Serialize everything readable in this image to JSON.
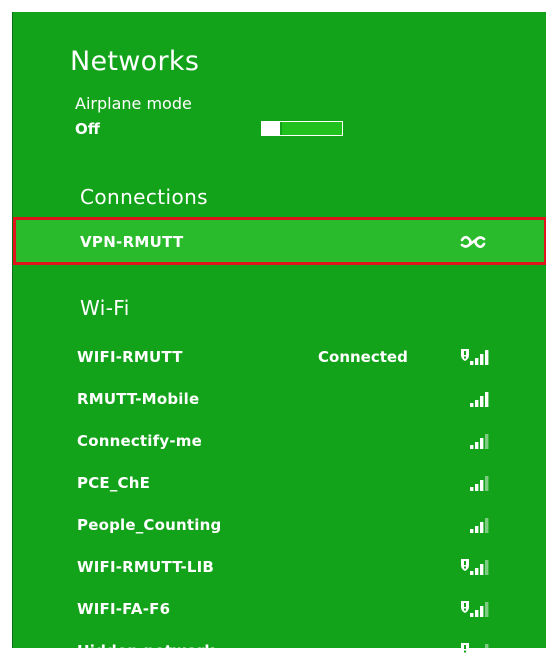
{
  "header": {
    "title": "Networks"
  },
  "airplane": {
    "label": "Airplane mode",
    "value": "Off"
  },
  "connections": {
    "title": "Connections",
    "vpn": {
      "label": "VPN-RMUTT",
      "icon": "vpn-link-icon"
    }
  },
  "wifi": {
    "title": "Wi-Fi",
    "networks": [
      {
        "name": "WIFI-RMUTT",
        "status": "Connected",
        "secured": true,
        "signal_bars": 4
      },
      {
        "name": "RMUTT-Mobile",
        "status": "",
        "secured": false,
        "signal_bars": 4
      },
      {
        "name": "Connectify-me",
        "status": "",
        "secured": false,
        "signal_bars": 3
      },
      {
        "name": "PCE_ChE",
        "status": "",
        "secured": false,
        "signal_bars": 3
      },
      {
        "name": "People_Counting",
        "status": "",
        "secured": false,
        "signal_bars": 3
      },
      {
        "name": "WIFI-RMUTT-LIB",
        "status": "",
        "secured": true,
        "signal_bars": 3
      },
      {
        "name": "WIFI-FA-F6",
        "status": "",
        "secured": true,
        "signal_bars": 3
      },
      {
        "name": "Hidden network",
        "status": "",
        "secured": true,
        "signal_bars": 3
      }
    ]
  },
  "colors": {
    "panel": "#13a31a",
    "highlight": "#29bb2c",
    "selection_border": "#e0141b"
  }
}
